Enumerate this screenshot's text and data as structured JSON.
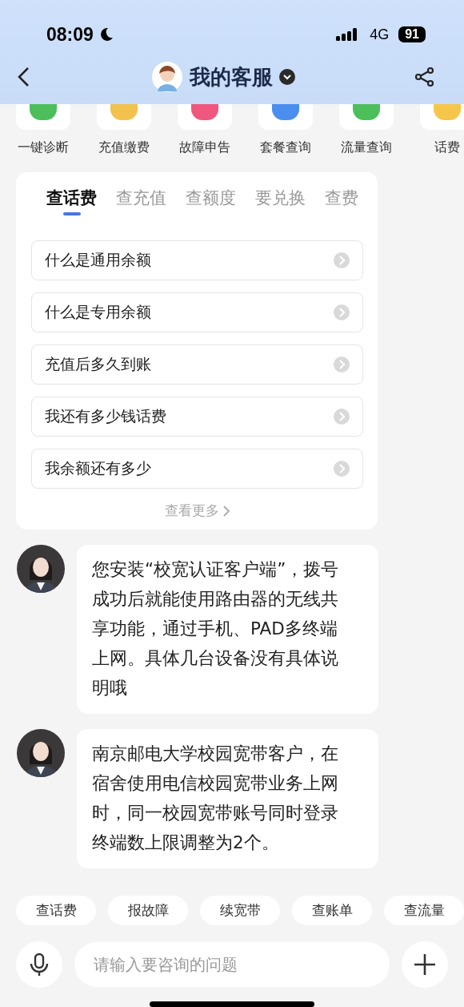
{
  "status_bar": {
    "time": "08:09",
    "network": "4G",
    "battery": "91"
  },
  "header": {
    "title": "我的客服"
  },
  "quick_actions": [
    {
      "label": "一键诊断",
      "color": "#4cbf5a"
    },
    {
      "label": "充值缴费",
      "color": "#f2c14e"
    },
    {
      "label": "故障申告",
      "color": "#f0577e"
    },
    {
      "label": "套餐查询",
      "color": "#4a8ef0"
    },
    {
      "label": "流量查询",
      "color": "#4cbf5a"
    },
    {
      "label": "话费",
      "color": "#f6c64a"
    }
  ],
  "faq_card": {
    "tabs": [
      {
        "label": "查话费",
        "selected": true
      },
      {
        "label": "查充值",
        "selected": false
      },
      {
        "label": "查额度",
        "selected": false
      },
      {
        "label": "要兑换",
        "selected": false
      },
      {
        "label": "查费",
        "selected": false
      }
    ],
    "questions": [
      "什么是通用余额",
      "什么是专用余额",
      "充值后多久到账",
      "我还有多少钱话费",
      "我余额还有多少"
    ],
    "more": "查看更多"
  },
  "messages": [
    {
      "text": "您安装“校宽认证客户端”，拨号成功后就能使用路由器的无线共享功能，通过手机、PAD多终端上网。具体几台设备没有具体说明哦"
    },
    {
      "text": "南京邮电大学校园宽带客户，在宿舍使用电信校园宽带业务上网时，同一校园宽带账号同时登录终端数上限调整为2个。"
    }
  ],
  "chips": [
    "查话费",
    "报故障",
    "续宽带",
    "查账单",
    "查流量"
  ],
  "input": {
    "placeholder": "请输入要咨询的问题"
  }
}
